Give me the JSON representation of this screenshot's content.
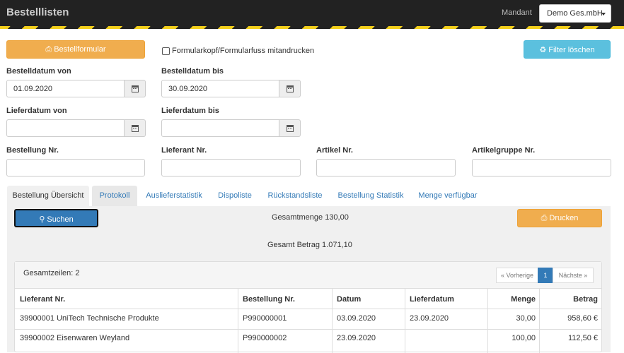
{
  "header": {
    "title": "Bestelllisten",
    "mandant_label": "Mandant",
    "mandant_value": "Demo Ges.mbH"
  },
  "toolbar": {
    "bestellformular_label": "Bestellformular",
    "checkbox_label": "Formularkopf/Formularfuss mitandrucken",
    "filter_clear_label": "Filter löschen"
  },
  "filters": {
    "bestelldatum_von_label": "Bestelldatum von",
    "bestelldatum_von_value": "01.09.2020",
    "bestelldatum_bis_label": "Bestelldatum bis",
    "bestelldatum_bis_value": "30.09.2020",
    "lieferdatum_von_label": "Lieferdatum von",
    "lieferdatum_von_value": "",
    "lieferdatum_bis_label": "Lieferdatum bis",
    "lieferdatum_bis_value": "",
    "bestellung_nr_label": "Bestellung Nr.",
    "lieferant_nr_label": "Lieferant Nr.",
    "artikel_nr_label": "Artikel Nr.",
    "artikelgruppe_nr_label": "Artikelgruppe Nr."
  },
  "tabs": [
    {
      "label": "Bestellung Übersicht"
    },
    {
      "label": "Protokoll"
    },
    {
      "label": "Auslieferstatistik"
    },
    {
      "label": "Dispoliste"
    },
    {
      "label": "Rückstandsliste"
    },
    {
      "label": "Bestellung Statistik"
    },
    {
      "label": "Menge verfügbar"
    }
  ],
  "panel": {
    "search_label": "Suchen",
    "print_label": "Drucken",
    "gesamtmenge": "Gesamtmenge 130,00",
    "gesamt_betrag": "Gesamt Betrag 1.071,10"
  },
  "table": {
    "row_count": "Gesamtzeilen: 2",
    "pager_prev": "« Vorherige",
    "pager_page": "1",
    "pager_next": "Nächste »",
    "columns": [
      "Lieferant Nr.",
      "Bestellung Nr.",
      "Datum",
      "Lieferdatum",
      "Menge",
      "Betrag"
    ],
    "rows": [
      [
        "39900001 UniTech Technische Produkte",
        "P990000001",
        "03.09.2020",
        "23.09.2020",
        "30,00",
        "958,60 €"
      ],
      [
        "39900002 Eisenwaren Weyland",
        "P990000002",
        "23.09.2020",
        "",
        "100,00",
        "112,50 €"
      ]
    ]
  },
  "colors": {
    "warning": "#f0ad4e",
    "info": "#5bc0de",
    "primary": "#337ab7",
    "topbar": "#222222",
    "stripe_yellow": "#f4d01c"
  }
}
